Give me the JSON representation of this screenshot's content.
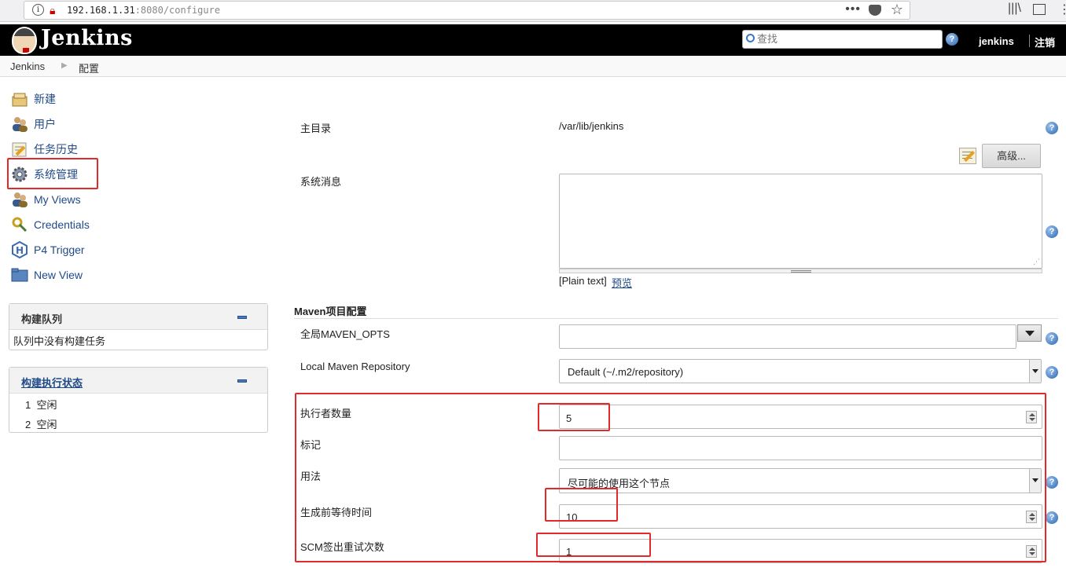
{
  "browser": {
    "url_host": "192.168.1.31",
    "url_rest": ":8080/configure",
    "menu_dots": "•••"
  },
  "header": {
    "logo": "Jenkins",
    "search_placeholder": "查找",
    "user": "jenkins",
    "logout": "注销"
  },
  "breadcrumb": [
    "Jenkins",
    "配置"
  ],
  "sidebar": {
    "items": [
      {
        "label": "新建",
        "icon": "new-item-icon"
      },
      {
        "label": "用户",
        "icon": "users-icon"
      },
      {
        "label": "任务历史",
        "icon": "build-history-icon"
      },
      {
        "label": "系统管理",
        "icon": "gear-icon"
      },
      {
        "label": "My Views",
        "icon": "users-icon"
      },
      {
        "label": "Credentials",
        "icon": "key-icon"
      },
      {
        "label": "P4 Trigger",
        "icon": "p4-icon"
      },
      {
        "label": "New View",
        "icon": "folder-icon"
      }
    ],
    "build_queue": {
      "title": "构建队列",
      "empty": "队列中没有构建任务"
    },
    "executors": {
      "title": "构建执行状态",
      "rows": [
        {
          "num": "1",
          "status": "空闲"
        },
        {
          "num": "2",
          "status": "空闲"
        }
      ]
    }
  },
  "form": {
    "home_dir_label": "主目录",
    "home_dir_value": "/var/lib/jenkins",
    "advanced_button": "高级...",
    "system_message_label": "系统消息",
    "system_message_value": "",
    "plain_text": "[Plain text]",
    "preview_link": "预览",
    "maven_section": "Maven项目配置",
    "maven_opts_label": "全局MAVEN_OPTS",
    "maven_opts_value": "",
    "local_repo_label": "Local Maven Repository",
    "local_repo_value": "Default (~/.m2/repository)",
    "executors_label": "执行者数量",
    "executors_value": "5",
    "labels_label": "标记",
    "labels_value": "",
    "usage_label": "用法",
    "usage_value": "尽可能的使用这个节点",
    "quiet_period_label": "生成前等待时间",
    "quiet_period_value": "10",
    "scm_retry_label": "SCM签出重试次数",
    "scm_retry_value": "1",
    "help_glyph": "?"
  },
  "colors": {
    "header_bg": "#000000",
    "link": "#204a87",
    "annotation_red": "#e32a2a"
  }
}
